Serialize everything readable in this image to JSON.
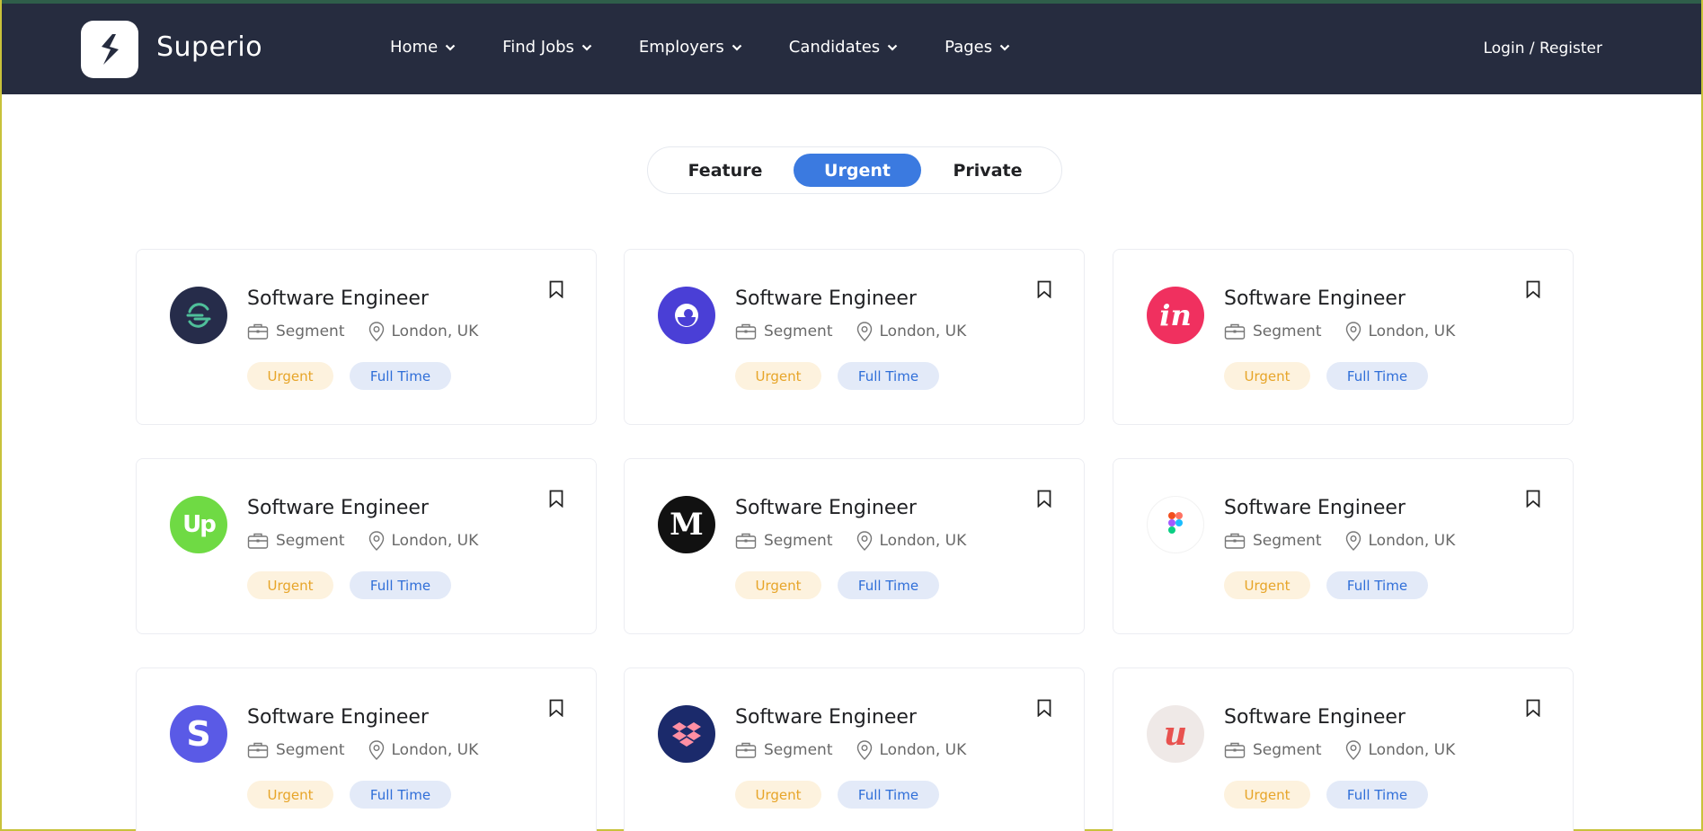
{
  "brand": {
    "name": "Superio"
  },
  "nav": {
    "items": [
      {
        "label": "Home"
      },
      {
        "label": "Find Jobs"
      },
      {
        "label": "Employers"
      },
      {
        "label": "Candidates"
      },
      {
        "label": "Pages"
      }
    ],
    "login_label": "Login / Register"
  },
  "tabs": [
    {
      "label": "Feature"
    },
    {
      "label": "Urgent",
      "active": true
    },
    {
      "label": "Private"
    }
  ],
  "colors": {
    "header_bg": "#262c3f",
    "accent": "#3b7ae0",
    "urgent_bg": "#fdf2de",
    "urgent_text": "#e7a529",
    "fulltime_bg": "#e3eaf8",
    "fulltime_text": "#2f6ed8"
  },
  "jobs": [
    {
      "title": "Software Engineer",
      "company": "Segment",
      "location": "London, UK",
      "tags": [
        "Urgent",
        "Full Time"
      ],
      "logo": "segment-logo-icon"
    },
    {
      "title": "Software Engineer",
      "company": "Segment",
      "location": "London, UK",
      "tags": [
        "Urgent",
        "Full Time"
      ],
      "logo": "purple-circle-logo-icon"
    },
    {
      "title": "Software Engineer",
      "company": "Segment",
      "location": "London, UK",
      "tags": [
        "Urgent",
        "Full Time"
      ],
      "logo": "invision-logo-icon"
    },
    {
      "title": "Software Engineer",
      "company": "Segment",
      "location": "London, UK",
      "tags": [
        "Urgent",
        "Full Time"
      ],
      "logo": "upwork-logo-icon"
    },
    {
      "title": "Software Engineer",
      "company": "Segment",
      "location": "London, UK",
      "tags": [
        "Urgent",
        "Full Time"
      ],
      "logo": "medium-logo-icon"
    },
    {
      "title": "Software Engineer",
      "company": "Segment",
      "location": "London, UK",
      "tags": [
        "Urgent",
        "Full Time"
      ],
      "logo": "figma-logo-icon"
    },
    {
      "title": "Software Engineer",
      "company": "Segment",
      "location": "London, UK",
      "tags": [
        "Urgent",
        "Full Time"
      ],
      "logo": "stripe-logo-icon"
    },
    {
      "title": "Software Engineer",
      "company": "Segment",
      "location": "London, UK",
      "tags": [
        "Urgent",
        "Full Time"
      ],
      "logo": "dropbox-logo-icon"
    },
    {
      "title": "Software Engineer",
      "company": "Segment",
      "location": "London, UK",
      "tags": [
        "Urgent",
        "Full Time"
      ],
      "logo": "udemy-logo-icon"
    }
  ]
}
